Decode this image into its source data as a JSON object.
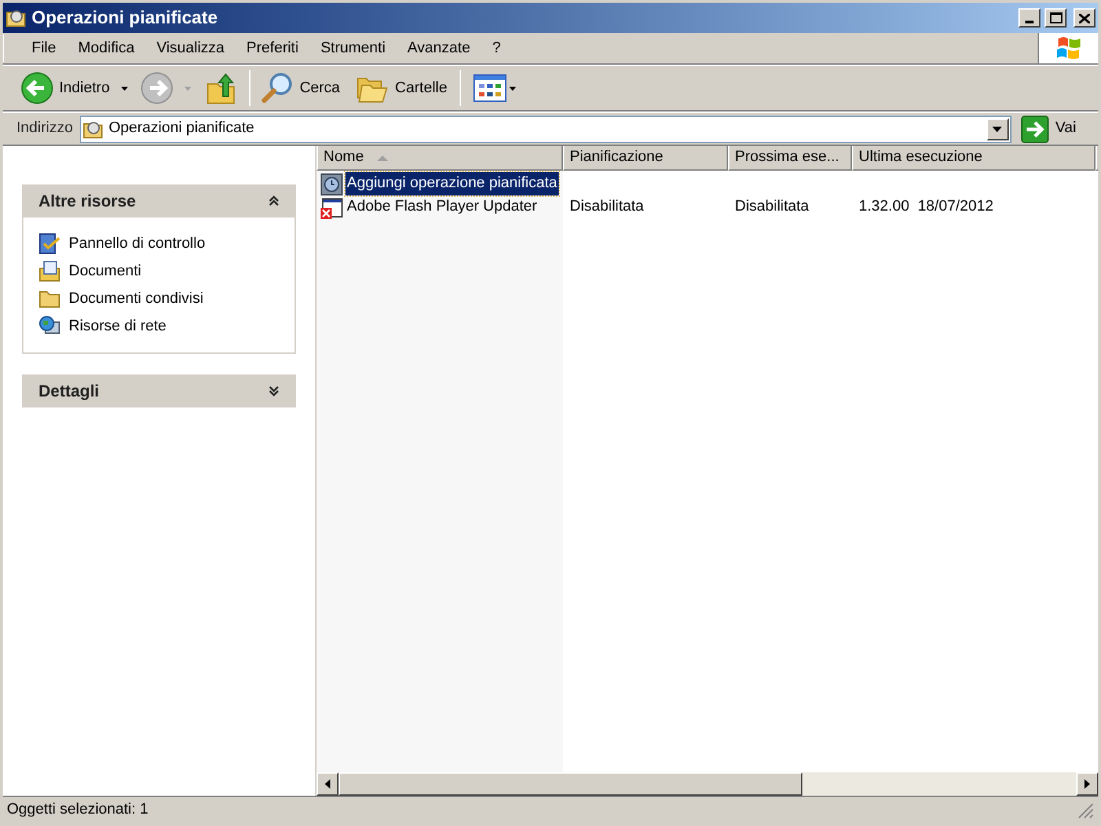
{
  "window": {
    "title": "Operazioni pianificate"
  },
  "menu": [
    {
      "label": "File"
    },
    {
      "label": "Modifica"
    },
    {
      "label": "Visualizza"
    },
    {
      "label": "Preferiti"
    },
    {
      "label": "Strumenti"
    },
    {
      "label": "Avanzate"
    },
    {
      "label": "?"
    }
  ],
  "toolbar": {
    "back": {
      "label": "Indietro",
      "disabled": false
    },
    "forward": {
      "disabled": true
    },
    "search": {
      "label": "Cerca"
    },
    "folders": {
      "label": "Cartelle"
    }
  },
  "address_bar": {
    "label": "Indirizzo",
    "value": "Operazioni pianificate",
    "go": "Vai"
  },
  "task_pane": [
    {
      "title": "Altre risorse",
      "expanded": true,
      "items": [
        {
          "label": "Pannello di controllo",
          "kind": "control-panel"
        },
        {
          "label": "Documenti",
          "kind": "documents"
        },
        {
          "label": "Documenti condivisi",
          "kind": "folder"
        },
        {
          "label": "Risorse di rete",
          "kind": "network"
        }
      ]
    },
    {
      "title": "Dettagli",
      "expanded": false
    }
  ],
  "table": {
    "columns": [
      {
        "label": "Nome",
        "sorted": true
      },
      {
        "label": "Pianificazione",
        "sorted": false
      },
      {
        "label": "Prossima ese...",
        "sorted": false
      },
      {
        "label": "Ultima esecuzione",
        "sorted": false
      }
    ],
    "rows": [
      {
        "name": "Aggiungi operazione pianificata",
        "kind": "wizard",
        "selected": true
      },
      {
        "name": "Adobe Flash Player Updater",
        "kind": "task-disabled",
        "selected": false,
        "cells": [
          "Disabilitata",
          "Disabilitata",
          "1.32.00  18/07/2012"
        ]
      }
    ]
  },
  "status_bar": "Oggetti selezionati: 1"
}
